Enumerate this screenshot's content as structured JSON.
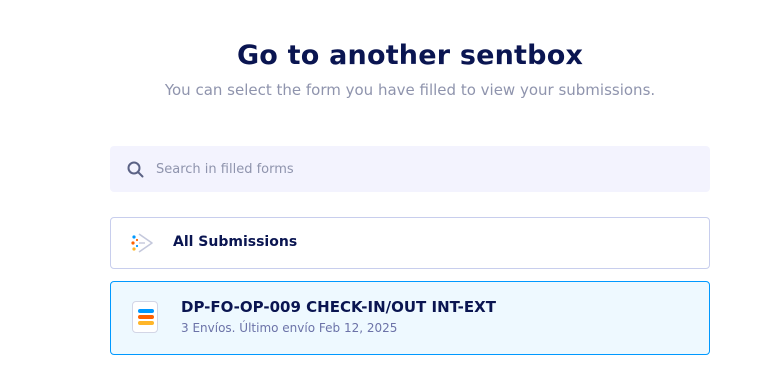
{
  "header": {
    "title": "Go to another sentbox",
    "subtitle": "You can select the form you have filled to view your submissions."
  },
  "search": {
    "placeholder": "Search in filled forms",
    "value": "",
    "icon": "search-icon"
  },
  "items": [
    {
      "label": "All Submissions",
      "icon": "all-submissions-icon",
      "selected": false
    },
    {
      "title": "DP-FO-OP-009 CHECK-IN/OUT INT-EXT",
      "meta": "3 Envíos. Último envío Feb 12, 2025",
      "icon": "form-icon",
      "selected": true
    }
  ],
  "colors": {
    "accent": "#0099ff",
    "title": "#0a1551",
    "muted": "#8f94ad",
    "search_bg": "#f3f3fe",
    "selected_bg": "#eef9ff",
    "icon_blue": "#0099ff",
    "icon_orange": "#ff6100",
    "icon_yellow": "#ffb629"
  }
}
